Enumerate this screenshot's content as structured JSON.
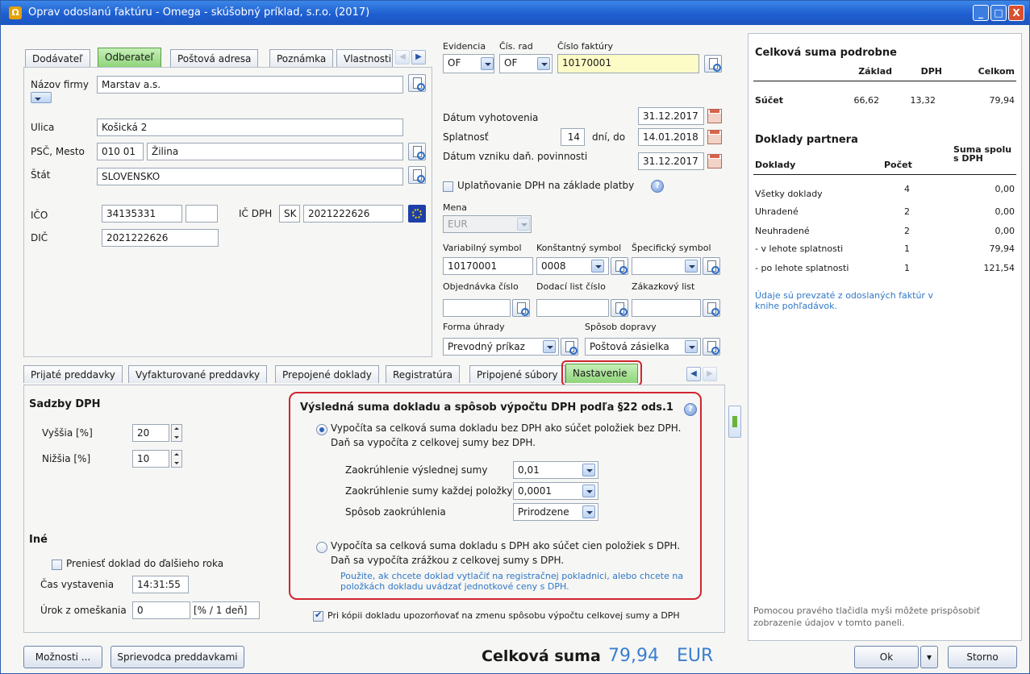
{
  "window": {
    "title": "Oprav odoslanú faktúru - Omega - skúšobný príklad, s.r.o. (2017)",
    "icon": "omega-icon",
    "buttons": [
      "_",
      "□",
      "X"
    ]
  },
  "partner_tabs": [
    "Dodávateľ",
    "Odberateľ",
    "Poštová adresa",
    "Poznámka",
    "Vlastnosti"
  ],
  "partner": {
    "firm_label": "Názov firmy",
    "firm": "Marstav a.s.",
    "street_label": "Ulica",
    "street": "Košická 2",
    "zip_city_label": "PSČ, Mesto",
    "zip": "010 01",
    "city": "Žilina",
    "country_label": "Štát",
    "country": "SLOVENSKO",
    "ico_label": "IČO",
    "ico": "34135331",
    "icdph_label": "IČ DPH",
    "icdph_prefix": "SK",
    "icdph": "2021222626",
    "dic_label": "DIČ",
    "dic": "2021222626"
  },
  "invoice": {
    "evidencia_label": "Evidencia",
    "evidencia": "OF",
    "cis_rad_label": "Čís. rad",
    "cis_rad": "OF",
    "cislo_label": "Číslo faktúry",
    "cislo": "10170001",
    "vyhotovenie_label": "Dátum vyhotovenia",
    "vyhotovenie": "31.12.2017",
    "splatnost_label": "Splatnosť",
    "splatnost_days": "14",
    "dni_do": "dní, do",
    "splatnost_date": "14.01.2018",
    "dan_label": "Dátum vzniku daň. povinnosti",
    "dan_date": "31.12.2017",
    "uplat_label": "Uplatňovanie DPH na základe platby",
    "mena_label": "Mena",
    "mena": "EUR",
    "vs_label": "Variabilný symbol",
    "vs": "10170001",
    "ks_label": "Konštantný symbol",
    "ks": "0008",
    "ss_label": "Špecifický symbol",
    "ss": "",
    "obj_label": "Objednávka číslo",
    "dl_label": "Dodací list číslo",
    "zak_label": "Zákazkový list",
    "forma_label": "Forma úhrady",
    "forma": "Prevodný príkaz",
    "doprava_label": "Spôsob dopravy",
    "doprava": "Poštová zásielka"
  },
  "summary": {
    "heading": "Celková suma podrobne",
    "cols": [
      "Základ",
      "DPH",
      "Celkom"
    ],
    "row_label": "Súčet",
    "values": [
      "66,62",
      "13,32",
      "79,94"
    ]
  },
  "partner_docs": {
    "heading": "Doklady partnera",
    "cols": [
      "Doklady",
      "Počet",
      "Suma spolu s DPH"
    ],
    "rows": [
      {
        "label": "Všetky doklady",
        "count": "4",
        "sum": "0,00"
      },
      {
        "label": "Uhradené",
        "count": "2",
        "sum": "0,00"
      },
      {
        "label": "Neuhradené",
        "count": "2",
        "sum": "0,00"
      },
      {
        "label": " - v lehote splatnosti",
        "count": "1",
        "sum": "79,94"
      },
      {
        "label": " - po lehote splatnosti",
        "count": "1",
        "sum": "121,54"
      }
    ],
    "note": "Údaje sú prevzaté z odoslaných faktúr v knihe pohľadávok.",
    "footer_note": "Pomocou pravého tlačidla myši môžete prispôsobiť zobrazenie údajov v tomto paneli."
  },
  "bottom_tabs": [
    "Prijaté preddavky",
    "Vyfakturované preddavky",
    "Prepojené doklady",
    "Registratúra",
    "Pripojené súbory",
    "Nastavenie"
  ],
  "settings": {
    "vat_heading": "Sadzby DPH",
    "higher_label": "Vyššia [%]",
    "higher": "20",
    "lower_label": "Nižšia [%]",
    "lower": "10",
    "other_heading": "Iné",
    "transfer_label": "Preniesť doklad do ďalšieho roka",
    "time_label": "Čas vystavenia",
    "time": "14:31:55",
    "interest_label": "Úrok z omeškania",
    "interest": "0",
    "interest_unit": "[% / 1 deň]",
    "result_heading": "Výsledná suma dokladu a spôsob výpočtu DPH podľa §22 ods.1",
    "opt1_line1": "Vypočíta sa celková suma dokladu bez DPH ako súčet položiek bez DPH.",
    "opt1_line2": "Daň sa vypočíta z celkovej sumy bez DPH.",
    "round_total_label": "Zaokrúhlenie výslednej sumy",
    "round_total": "0,01",
    "round_item_label": "Zaokrúhlenie sumy každej položky",
    "round_item": "0,0001",
    "round_method_label": "Spôsob zaokrúhlenia",
    "round_method": "Prirodzene",
    "opt2_line1": "Vypočíta sa celková suma dokladu s DPH ako súčet cien položiek s DPH.",
    "opt2_line2": "Daň sa vypočíta zrážkou z celkovej sumy s DPH.",
    "opt2_note1": "Použite, ak chcete doklad vytlačiť na registračnej pokladnici, alebo chcete na",
    "opt2_note2": "položkách dokladu uvádzať jednotkové ceny s DPH.",
    "copy_warn_label": "Pri kópii dokladu upozorňovať na zmenu spôsobu výpočtu celkovej sumy a DPH"
  },
  "footer": {
    "options_btn": "Možnosti ...",
    "guide_btn": "Sprievodca preddavkami",
    "total_label": "Celková suma",
    "total_value": "79,94",
    "currency": "EUR",
    "ok_btn": "Ok",
    "cancel_btn": "Storno"
  },
  "colors": {
    "title_bar": "#1f5fd0",
    "highlight_border": "#d0262f",
    "total_value": "#3a7fd0",
    "active_tab": "#8fd47a",
    "note": "#2f78c6"
  }
}
